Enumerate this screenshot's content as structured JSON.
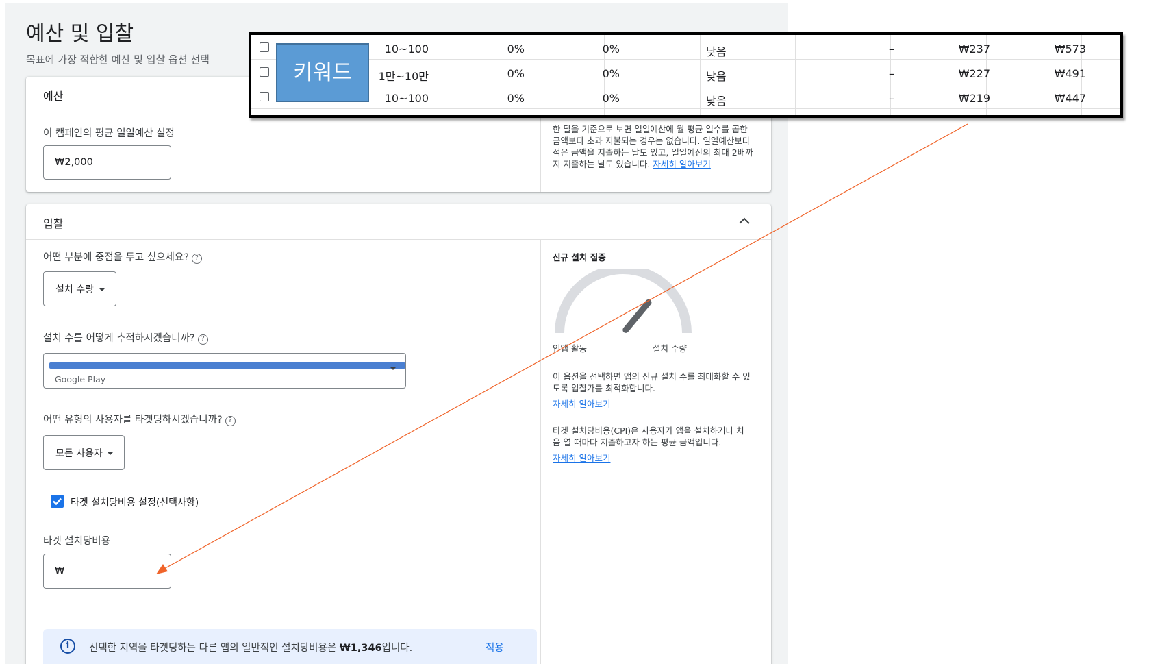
{
  "page": {
    "title": "예산 및 입찰",
    "subtitle": "목표에 가장 적합한 예산 및 입찰 옵션 선택"
  },
  "budget": {
    "header": "예산",
    "field_label": "이 캠페인의 평균 일일예산 설정",
    "field_value": "₩2,000",
    "side_text": "한 달을 기준으로 보면 일일예산에 월 평균 일수를 곱한 금액보다 초과 지불되는 경우는 없습니다. 일일예산보다 적은 금액을 지출하는 날도 있고, 일일예산의 최대 2배까지 지출하는 날도 있습니다.",
    "side_link": "자세히 알아보기"
  },
  "bidding": {
    "header": "입찰",
    "focus_question": "어떤 부분에 중점을 두고 싶으세요?",
    "focus_value": "설치 수량",
    "track_question": "설치 수를 어떻게 추적하시겠습니까?",
    "track_secondary": "Google Play",
    "user_question": "어떤 유형의 사용자를 타겟팅하시겠습니까?",
    "user_value": "모든 사용자",
    "checkbox_label": "타겟 설치당비용 설정(선택사항)",
    "target_label": "타겟 설치당비용",
    "target_value": "₩",
    "info_text_pre": "선택한 지역을 타겟팅하는 다른 앱의 일반적인 설치당비용은 ",
    "info_text_bold": "₩1,346",
    "info_text_post": "입니다.",
    "apply_label": "적용",
    "gauge": {
      "title": "신규 설치 집중",
      "left_label": "인앱 활동",
      "right_label": "설치 수량",
      "level": 0.72
    },
    "side_text_1": "이 옵션을 선택하면 앱의 신규 설치 수를 최대화할 수 있도록 입찰가를 최적화합니다.",
    "side_link_1": "자세히 알아보기",
    "side_text_2": "타겟 설치당비용(CPI)은 사용자가 앱을 설치하거나 처음 열 때마다 지출하고자 하는 평균 금액입니다.",
    "side_link_2": "자세히 알아보기"
  },
  "overlay": {
    "keyword_label": "키워드",
    "rows": [
      {
        "searches": "10~100",
        "change_3m": "0%",
        "change_yoy": "0%",
        "competition": "낮음",
        "impression_share": "–",
        "bid_low": "₩237",
        "bid_high": "₩573"
      },
      {
        "searches": "1만~10만",
        "change_3m": "0%",
        "change_yoy": "0%",
        "competition": "낮음",
        "impression_share": "–",
        "bid_low": "₩227",
        "bid_high": "₩491"
      },
      {
        "searches": "10~100",
        "change_3m": "0%",
        "change_yoy": "0%",
        "competition": "낮음",
        "impression_share": "–",
        "bid_low": "₩219",
        "bid_high": "₩447"
      }
    ]
  },
  "colors": {
    "accent": "#1a73e8",
    "redaction": "#4a7fd1",
    "annotation_arrow": "#f0642a",
    "keyword_box": "#5b9bd5"
  }
}
